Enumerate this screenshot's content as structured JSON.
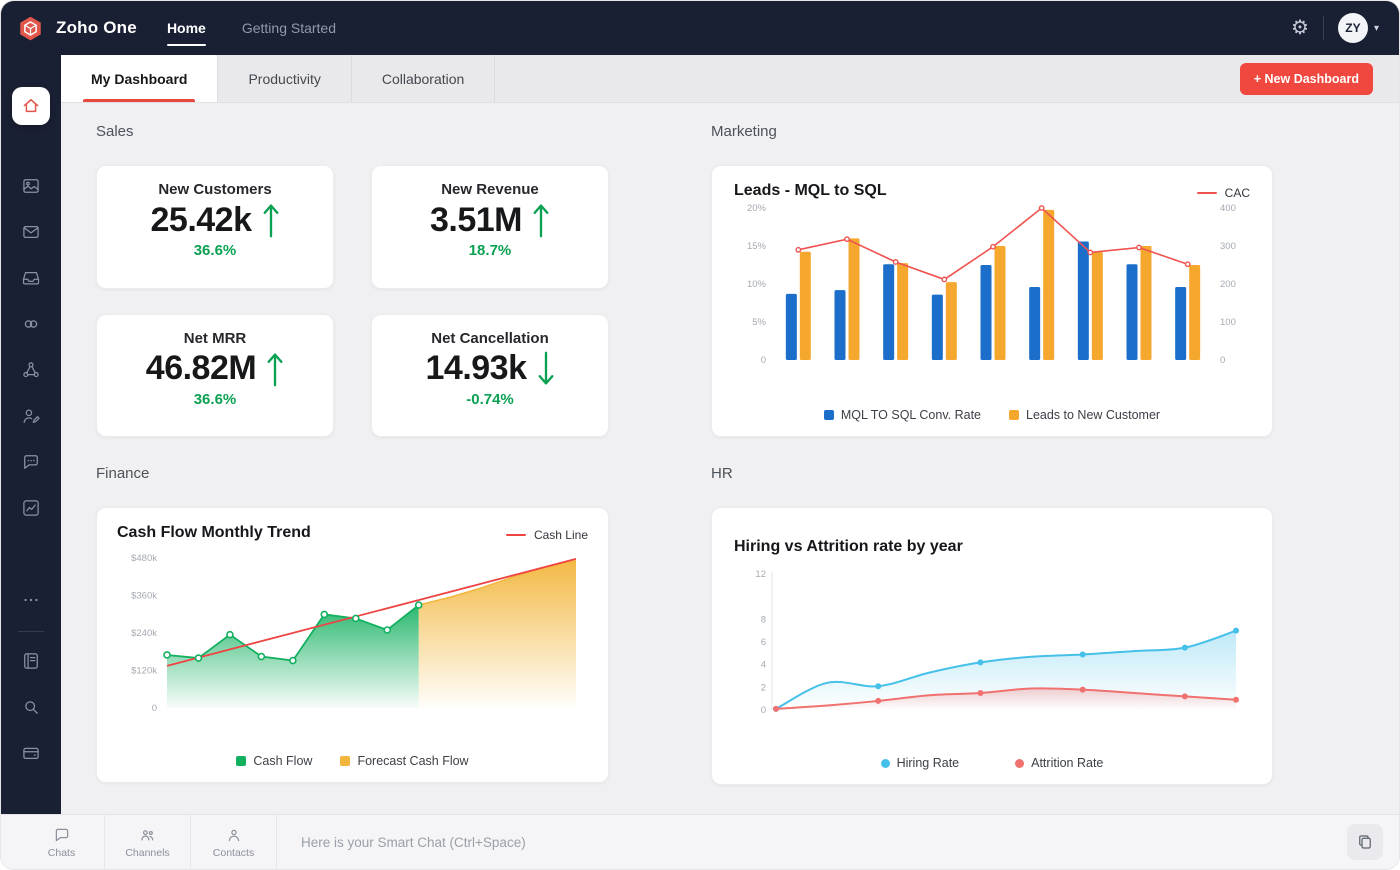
{
  "topbar": {
    "brand": "Zoho One",
    "nav": [
      {
        "label": "Home",
        "active": true
      },
      {
        "label": "Getting Started",
        "active": false
      }
    ],
    "avatar": "ZY"
  },
  "tabs": {
    "items": [
      {
        "label": "My Dashboard",
        "active": true
      },
      {
        "label": "Productivity",
        "active": false
      },
      {
        "label": "Collaboration",
        "active": false
      }
    ],
    "new_dashboard_label": "+ New Dashboard"
  },
  "sections": {
    "sales": "Sales",
    "marketing": "Marketing",
    "finance": "Finance",
    "hr": "HR"
  },
  "sales_cards": [
    {
      "title": "New Customers",
      "value": "25.42k",
      "delta": "36.6%",
      "direction": "up"
    },
    {
      "title": "New Revenue",
      "value": "3.51M",
      "delta": "18.7%",
      "direction": "up"
    },
    {
      "title": "Net MRR",
      "value": "46.82M",
      "delta": "36.6%",
      "direction": "up"
    },
    {
      "title": "Net Cancellation",
      "value": "14.93k",
      "delta": "-0.74%",
      "direction": "down"
    }
  ],
  "chart_data": [
    {
      "type": "bar",
      "title": "Leads - MQL to SQL",
      "left_axis": {
        "max": 20,
        "ticks": [
          0,
          5,
          10,
          15,
          20
        ],
        "format": "percent"
      },
      "right_axis": {
        "max": 400,
        "ticks": [
          0,
          100,
          200,
          300,
          400
        ]
      },
      "x_labels_visible": false,
      "legend_position": "bottom",
      "series": [
        {
          "name": "MQL TO SQL Conv. Rate",
          "kind": "bar",
          "axis": "left",
          "color": "#1b6ec9",
          "values": [
            8.7,
            9.2,
            12.6,
            8.6,
            12.5,
            9.6,
            15.6,
            12.6,
            9.6
          ]
        },
        {
          "name": "Leads to New Customer",
          "kind": "bar",
          "axis": "right",
          "color": "#f5a72e",
          "values": [
            285,
            320,
            255,
            205,
            300,
            395,
            285,
            300,
            250
          ]
        },
        {
          "name": "CAC",
          "kind": "line",
          "axis": "right",
          "color": "#ef5350",
          "values": [
            290,
            318,
            258,
            212,
            298,
            400,
            283,
            296,
            252
          ]
        }
      ]
    },
    {
      "type": "area",
      "title": "Cash Flow Monthly Trend",
      "y_axis": {
        "max": 500,
        "ticks": [
          0,
          120,
          240,
          360,
          480
        ],
        "labels": [
          "0",
          "$120k",
          "$240k",
          "$360k",
          "$480k"
        ]
      },
      "x_labels_visible": false,
      "legend_position": "bottom",
      "series": [
        {
          "name": "Cash Flow",
          "kind": "area",
          "color": "#12b05f",
          "values": [
            170,
            160,
            235,
            165,
            152,
            300,
            287,
            250,
            330
          ]
        },
        {
          "name": "Forecast Cash Flow",
          "kind": "area",
          "color": "#f2b63c",
          "values": [
            330,
            355,
            385,
            420,
            450,
            472
          ]
        },
        {
          "name": "Cash Line",
          "kind": "trend",
          "color": "#ef4444",
          "start": 135,
          "end": 478
        }
      ]
    },
    {
      "type": "line",
      "title": "Hiring vs Attrition rate by year",
      "y_axis": {
        "max": 12,
        "ticks": [
          0,
          2,
          4,
          6,
          8,
          12
        ]
      },
      "x_labels_visible": false,
      "legend_position": "bottom",
      "series": [
        {
          "name": "Hiring Rate",
          "kind": "line",
          "color": "#45c0e9",
          "values": [
            0.1,
            2.4,
            2.1,
            3.3,
            4.2,
            4.7,
            4.9,
            5.2,
            5.5,
            7
          ]
        },
        {
          "name": "Attrition Rate",
          "kind": "line",
          "color": "#f0716f",
          "values": [
            0.1,
            0.4,
            0.8,
            1.3,
            1.5,
            1.9,
            1.8,
            1.5,
            1.2,
            0.9
          ]
        }
      ]
    }
  ],
  "bottombar": {
    "dock": [
      {
        "label": "Chats"
      },
      {
        "label": "Channels"
      },
      {
        "label": "Contacts"
      }
    ],
    "chat_placeholder": "Here is your Smart Chat (Ctrl+Space)"
  },
  "sidebar": {
    "items": [
      "home",
      "gallery",
      "mail",
      "inbox",
      "link",
      "network",
      "user-edit",
      "chat",
      "analytics",
      "more",
      "notebook",
      "search",
      "wallet"
    ]
  },
  "colors": {
    "navy": "#1a2033",
    "accent_red": "#f0483e",
    "green": "#0ba152",
    "bar_blue": "#1b6ec9",
    "bar_orange": "#f5a72e",
    "line_red": "#ef5350",
    "cash_green": "#12b05f",
    "forecast_yellow": "#f2b63c",
    "trend_red": "#ef4444",
    "hiring_blue": "#45c0e9",
    "attrition_red": "#f0716f"
  }
}
